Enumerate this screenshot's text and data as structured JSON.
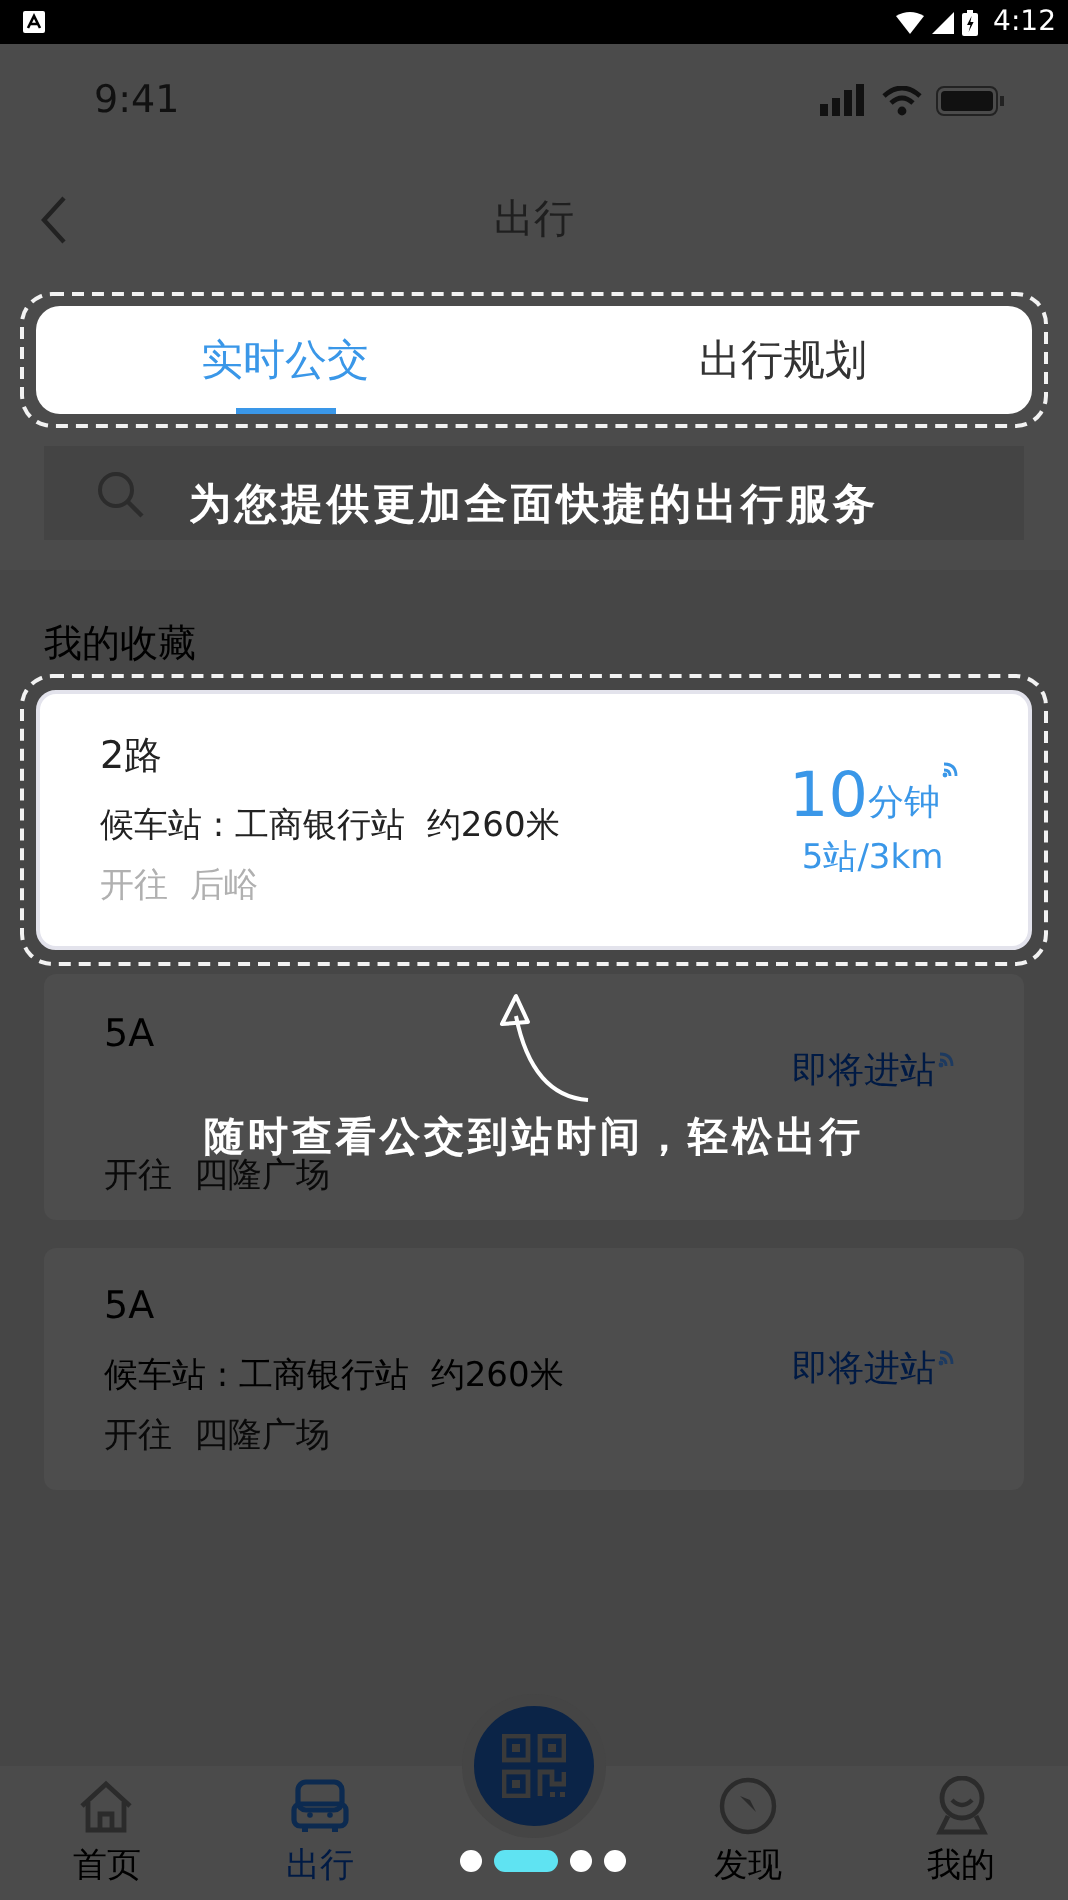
{
  "system_status": {
    "time": "4:12"
  },
  "app_status": {
    "time": "9:41"
  },
  "nav": {
    "title": "出行"
  },
  "tab_bar": {
    "highlighted": true,
    "tabs": [
      {
        "label": "实时公交",
        "selected": true
      },
      {
        "label": "出行规划",
        "selected": false
      }
    ]
  },
  "favorites": {
    "title": "我的收藏",
    "items": [
      {
        "route": "2路",
        "stop": "候车站 : 工商银行站  约260米",
        "destination": "开往  后峪",
        "kind": "eta",
        "eta_value": "10",
        "eta_unit": "分钟",
        "eta_detail": "5站/3km",
        "highlighted": true
      },
      {
        "route": "5A",
        "destination": "开往  四隆广场",
        "kind": "arriving",
        "status": "即将进站",
        "highlighted": false
      },
      {
        "route": "5A",
        "stop": "候车站 : 工商银行站  约260米",
        "destination": "开往  四隆广场",
        "kind": "arriving",
        "status": "即将进站",
        "highlighted": false
      }
    ]
  },
  "guide": {
    "tips": [
      "为您提供更加全面快捷的出行服务",
      "随时查看公交到站时间，轻松出行"
    ],
    "pages": [
      {
        "selected": false
      },
      {
        "selected": true
      },
      {
        "selected": false
      },
      {
        "selected": false
      }
    ]
  },
  "bottom_nav": [
    {
      "kind": "home",
      "label": "首页",
      "selected": false
    },
    {
      "kind": "car",
      "label": "出行",
      "selected": true
    },
    {
      "kind": "qr"
    },
    {
      "kind": "compass",
      "label": "发现",
      "selected": false
    },
    {
      "kind": "user",
      "label": "我的",
      "selected": false
    }
  ]
}
